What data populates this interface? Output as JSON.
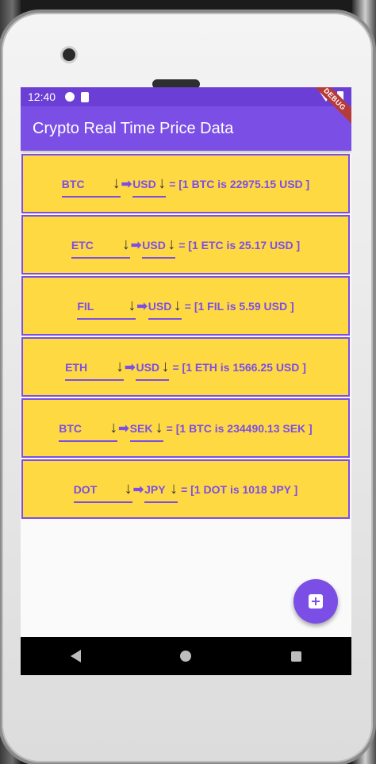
{
  "status_bar": {
    "time": "12:40",
    "debug_banner": "DEBUG"
  },
  "app_bar": {
    "title": "Crypto Real Time Price Data"
  },
  "rows": [
    {
      "from": "BTC",
      "to": "USD",
      "result": "= [1 BTC is 22975.15 USD ]"
    },
    {
      "from": "ETC",
      "to": "USD",
      "result": "= [1 ETC is 25.17 USD ]"
    },
    {
      "from": "FIL",
      "to": "USD",
      "result": "= [1 FIL is 5.59 USD ]"
    },
    {
      "from": "ETH",
      "to": "USD",
      "result": "= [1 ETH is 1566.25 USD ]"
    },
    {
      "from": "BTC",
      "to": "SEK",
      "result": "= [1 BTC is 234490.13 SEK ]"
    },
    {
      "from": "DOT",
      "to": "JPY",
      "result": "= [1 DOT is 1018 JPY ]"
    }
  ],
  "glyphs": {
    "dropdown_arrow": "↓",
    "pointer": "➡"
  },
  "icons": {
    "fab": "add-box-icon",
    "nav_back": "back-triangle-icon",
    "nav_home": "home-circle-icon",
    "nav_recent": "recent-square-icon"
  },
  "colors": {
    "primary": "#7b4fe6",
    "status": "#6b3fd6",
    "card": "#ffd942"
  }
}
